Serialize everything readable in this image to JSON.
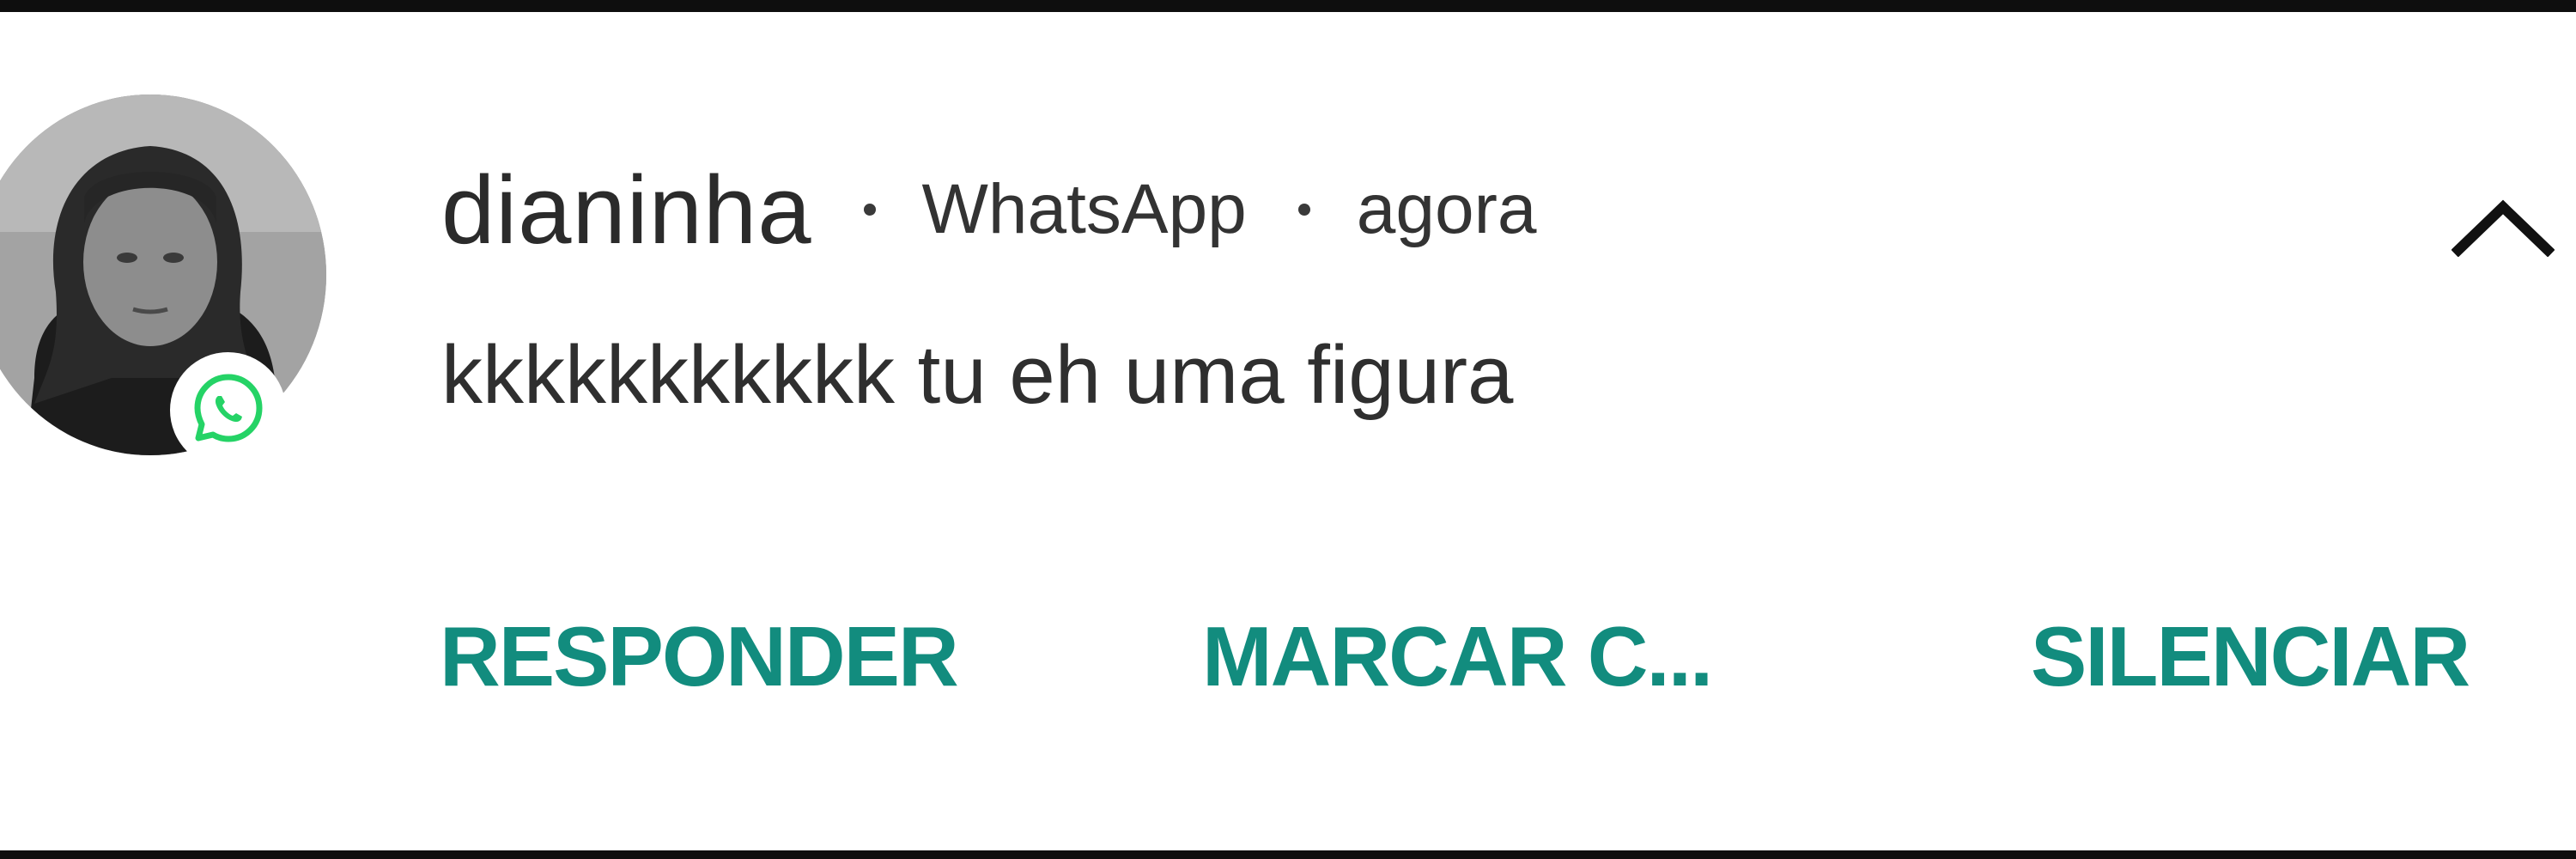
{
  "notification": {
    "sender": "dianinha",
    "app_name": "WhatsApp",
    "time": "agora",
    "message": "kkkkkkkkkkk tu eh uma figura",
    "separator": "•"
  },
  "actions": {
    "reply_label": "RESPONDER",
    "mark_read_label": "MARCAR C...",
    "mute_label": "SILENCIAR"
  },
  "colors": {
    "accent": "#128c7e",
    "whatsapp_green": "#25d366",
    "text": "#2b2b2b",
    "background": "#ffffff"
  },
  "icons": {
    "badge": "whatsapp-icon",
    "collapse": "chevron-up-icon"
  }
}
